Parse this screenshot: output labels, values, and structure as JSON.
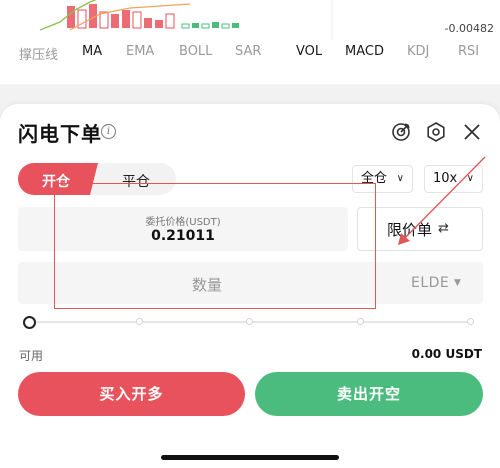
{
  "chart": {
    "right_value": "-0.00482"
  },
  "indicators": [
    {
      "label": "撑压线",
      "active": false
    },
    {
      "label": "MA",
      "active": true
    },
    {
      "label": "EMA",
      "active": false
    },
    {
      "label": "BOLL",
      "active": false
    },
    {
      "label": "SAR",
      "active": false
    },
    {
      "label": "VOL",
      "active": true
    },
    {
      "label": "MACD",
      "active": true
    },
    {
      "label": "KDJ",
      "active": false
    },
    {
      "label": "RSI",
      "active": false
    }
  ],
  "panel": {
    "title": "闪电下单",
    "info_icon": "info-icon",
    "header_icons": [
      "target-icon",
      "settings-icon",
      "close-icon"
    ]
  },
  "tabs": {
    "open_label": "开仓",
    "close_label": "平仓",
    "active": "open"
  },
  "margin_mode": {
    "value": "全仓",
    "icon": "chevron-down-icon"
  },
  "leverage": {
    "value": "10x",
    "icon": "chevron-down-icon"
  },
  "price": {
    "label": "委托价格(USDT)",
    "value": "0.21011"
  },
  "order_type": {
    "label": "限价单",
    "icon": "swap-icon"
  },
  "quantity": {
    "placeholder": "数量",
    "unit": "ELDE"
  },
  "slider": {
    "level": 0
  },
  "available": {
    "label": "可用",
    "value": "0.00 USDT"
  },
  "actions": {
    "buy_label": "买入开多",
    "sell_label": "卖出开空"
  },
  "colors": {
    "buy": "#e8525d",
    "sell": "#4cbb7e",
    "annotation": "#e15656"
  }
}
